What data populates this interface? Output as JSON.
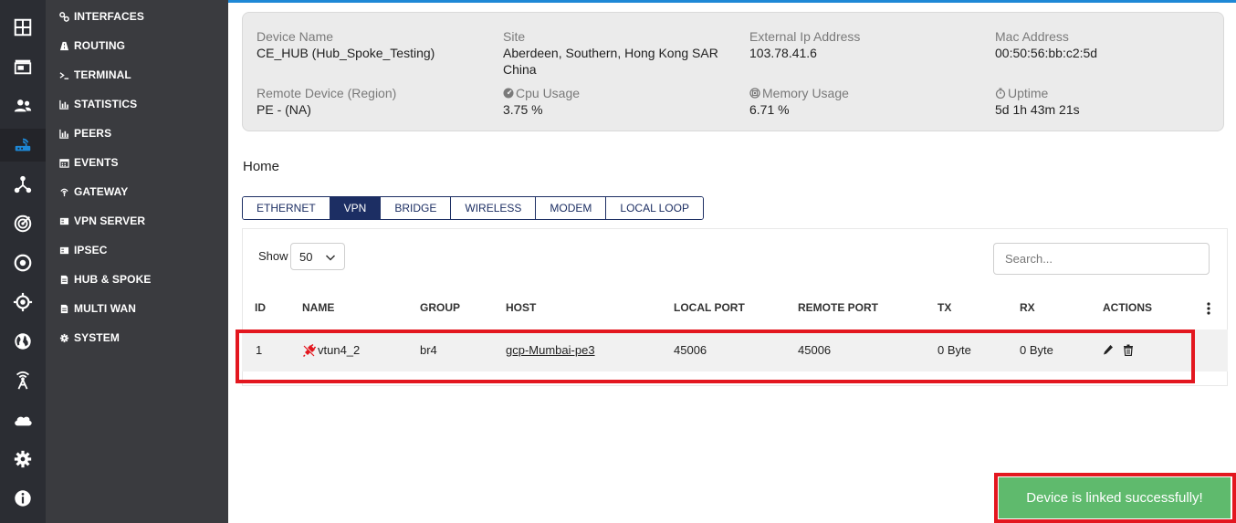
{
  "rail": {
    "icons": [
      "dashboard-icon",
      "store-icon",
      "users-icon",
      "router-icon",
      "topology-icon",
      "radar-icon",
      "target-icon",
      "crosshair-icon",
      "globe-icon",
      "antenna-icon",
      "cloud-icon",
      "settings-icon",
      "info-icon"
    ],
    "active_icon": "router-icon",
    "accent": "#1e88d6"
  },
  "menu": {
    "items": [
      {
        "label": "INTERFACES",
        "icon": "link-icon"
      },
      {
        "label": "ROUTING",
        "icon": "road-icon"
      },
      {
        "label": "TERMINAL",
        "icon": "terminal-icon"
      },
      {
        "label": "STATISTICS",
        "icon": "bar-chart-icon"
      },
      {
        "label": "PEERS",
        "icon": "bar-chart-icon"
      },
      {
        "label": "EVENTS",
        "icon": "calendar-icon"
      },
      {
        "label": "GATEWAY",
        "icon": "broadcast-icon"
      },
      {
        "label": "VPN SERVER",
        "icon": "server-icon"
      },
      {
        "label": "IPSEC",
        "icon": "server-icon"
      },
      {
        "label": "HUB & SPOKE",
        "icon": "document-icon"
      },
      {
        "label": "MULTI WAN",
        "icon": "document-icon"
      },
      {
        "label": "SYSTEM",
        "icon": "gear-icon"
      }
    ]
  },
  "device": {
    "name_label": "Device Name",
    "name_value": "CE_HUB (Hub_Spoke_Testing)",
    "site_label": "Site",
    "site_value_line1": "Aberdeen, Southern, Hong Kong SAR",
    "site_value_line2": "China",
    "ext_ip_label": "External Ip Address",
    "ext_ip_value": "103.78.41.6",
    "mac_label": "Mac Address",
    "mac_value": "00:50:56:bb:c2:5d",
    "remote_label": "Remote Device (Region)",
    "remote_value": "PE - (NA)",
    "cpu_label": "Cpu Usage",
    "cpu_value": "3.75 %",
    "mem_label": "Memory Usage",
    "mem_value": "6.71 %",
    "uptime_label": "Uptime",
    "uptime_value": "5d 1h 43m 21s"
  },
  "breadcrumb": "Home",
  "tabs": [
    {
      "label": "ETHERNET",
      "active": false
    },
    {
      "label": "VPN",
      "active": true
    },
    {
      "label": "BRIDGE",
      "active": false
    },
    {
      "label": "WIRELESS",
      "active": false
    },
    {
      "label": "MODEM",
      "active": false
    },
    {
      "label": "LOCAL LOOP",
      "active": false
    }
  ],
  "table": {
    "show_label": "Show",
    "page_size": "50",
    "search_placeholder": "Search...",
    "columns": [
      "ID",
      "NAME",
      "GROUP",
      "HOST",
      "LOCAL PORT",
      "REMOTE PORT",
      "TX",
      "RX",
      "ACTIONS"
    ],
    "rows": [
      {
        "id": "1",
        "name": "vtun4_2",
        "group": "br4",
        "host": "gcp-Mumbai-pe3",
        "local_port": "45006",
        "remote_port": "45006",
        "tx": "0 Byte",
        "rx": "0 Byte",
        "status_icon": "disconnected-plug-icon",
        "status_color": "#e3171f"
      }
    ]
  },
  "toast": {
    "message": "Device is linked successfully!",
    "color": "#5fba6d"
  },
  "highlight_color": "#e3171f"
}
